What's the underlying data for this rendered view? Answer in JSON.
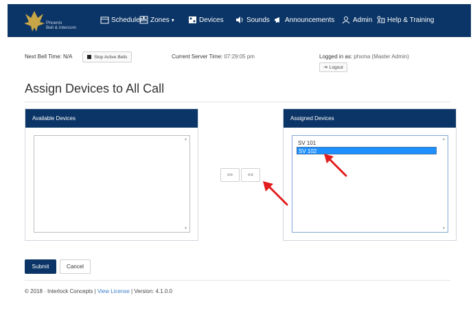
{
  "brand": {
    "name_line1": "Phoenix",
    "name_line2": "Bell & Intercom"
  },
  "nav": {
    "items": [
      {
        "label": "Scheduler",
        "icon": "calendar-icon"
      },
      {
        "label": "Zones",
        "icon": "zones-icon",
        "dropdown": "▾"
      },
      {
        "label": "Devices",
        "icon": "devices-icon"
      },
      {
        "label": "Sounds",
        "icon": "speaker-icon"
      },
      {
        "label": "Announcements",
        "icon": "megaphone-icon"
      },
      {
        "label": "Admin",
        "icon": "user-icon"
      },
      {
        "label": "Help & Training",
        "icon": "help-icon"
      }
    ]
  },
  "status": {
    "next_bell_label": "Next Bell Time:",
    "next_bell_value": "N/A",
    "stop_bells_label": "Stop Active Bells",
    "server_time_label": "Current Server Time:",
    "server_time_value": "07:29:05 pm",
    "logged_in_label": "Logged in as:",
    "logged_in_value": "phxma (Master Admin)",
    "logout_label": "Logout"
  },
  "page": {
    "title": "Assign Devices to All Call"
  },
  "available": {
    "header": "Available Devices",
    "items": []
  },
  "assigned": {
    "header": "Assigned Devices",
    "items": [
      {
        "label": "SV 101",
        "selected": false
      },
      {
        "label": "SV 102",
        "selected": true
      }
    ]
  },
  "controls": {
    "add_label": ">>",
    "remove_label": "<<"
  },
  "form": {
    "submit_label": "Submit",
    "cancel_label": "Cancel"
  },
  "footer": {
    "copyright": "© 2018 · Interlock Concepts |",
    "license_link": "View License",
    "version": "| Version: 4.1.0.0"
  },
  "colors": {
    "brand_navy": "#0b3566",
    "selection_blue": "#1e90ff",
    "annotation_red": "#e21d1d"
  }
}
